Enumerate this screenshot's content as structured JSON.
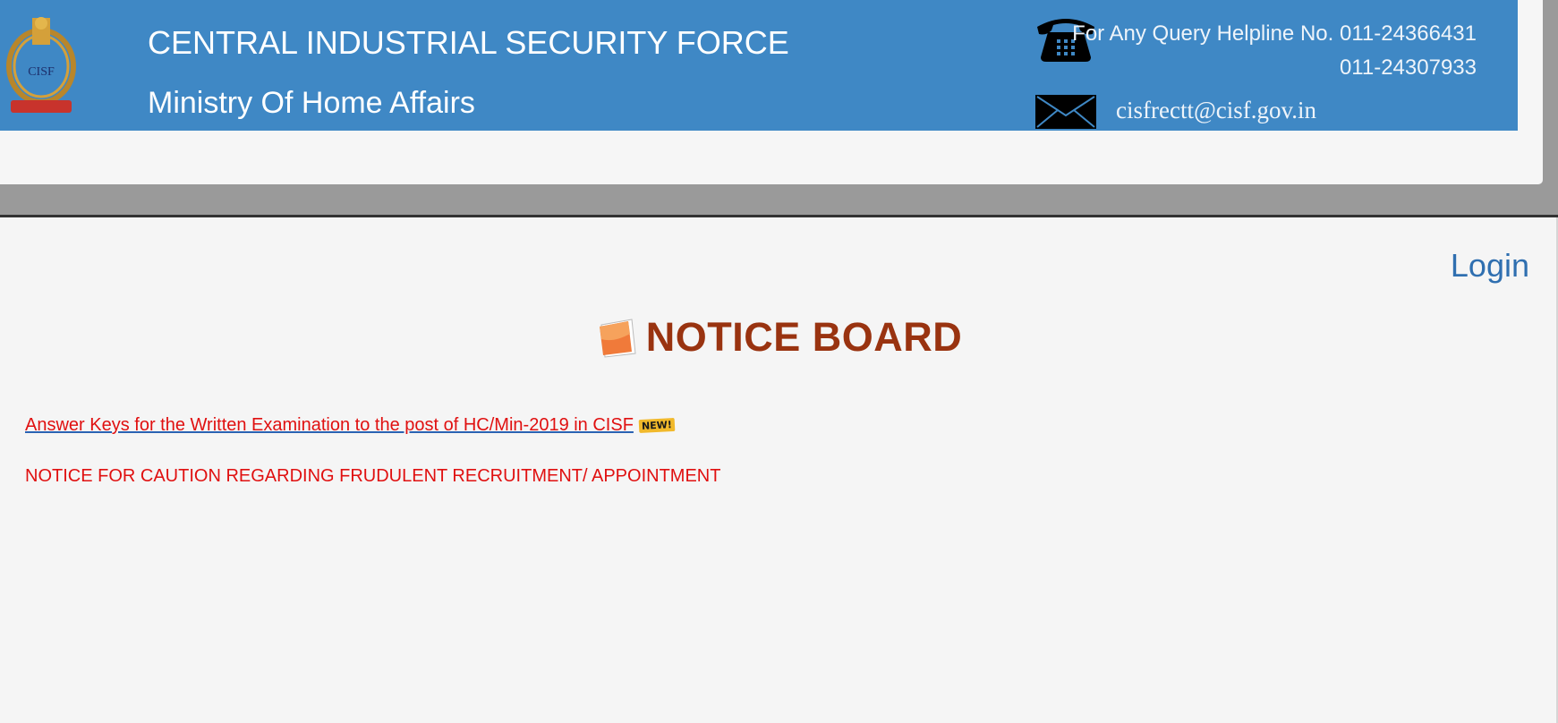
{
  "header": {
    "org_title": "CENTRAL INDUSTRIAL SECURITY FORCE",
    "ministry": "Ministry Of Home Affairs",
    "helpline_label": "For Any Query Helpline No. 011-24366431",
    "helpline_2": "011-24307933",
    "email": "cisfrectt@cisf.gov.in",
    "emblem_text": "CISF",
    "colors": {
      "banner": "#3f88c5",
      "text": "#ffffff"
    },
    "icons": {
      "phone": "telephone-icon",
      "mail": "envelope-icon",
      "emblem": "cisf-emblem-icon"
    }
  },
  "main": {
    "login_label": "Login",
    "notice_title": "NOTICE BOARD",
    "notices": [
      {
        "text": "Answer Keys for the Written Examination to the post of HC/Min-2019 in CISF",
        "badge": "NEW!"
      },
      {
        "text": "NOTICE FOR CAUTION REGARDING FRUDULENT RECRUITMENT/ APPOINTMENT"
      }
    ],
    "colors": {
      "title": "#993310",
      "notice": "#e01010",
      "link": "#2f6fb0"
    }
  }
}
